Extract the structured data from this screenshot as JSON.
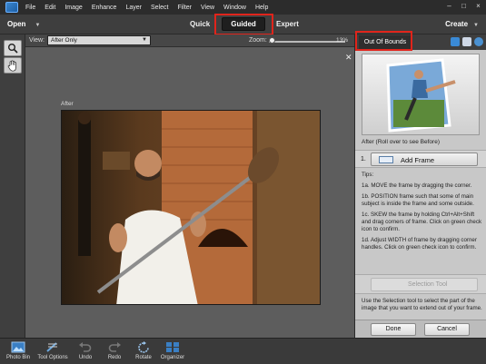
{
  "menubar": {
    "items": [
      "File",
      "Edit",
      "Image",
      "Enhance",
      "Layer",
      "Select",
      "Filter",
      "View",
      "Window",
      "Help"
    ]
  },
  "modebar": {
    "open_label": "Open",
    "modes": [
      "Quick",
      "Guided",
      "Expert"
    ],
    "active_mode": "Guided",
    "create_label": "Create"
  },
  "options": {
    "view_label": "View:",
    "view_value": "After Only",
    "zoom_label": "Zoom:",
    "zoom_value": "13%"
  },
  "canvas": {
    "after_label": "After"
  },
  "panel": {
    "title": "Out Of Bounds",
    "preview_caption": "After (Roll over to see Before)",
    "step_number": "1.",
    "step_button": "Add Frame",
    "tips_heading": "Tips:",
    "tips": [
      "1a. MOVE the frame by dragging the corner.",
      "1b. POSITION frame such that some of main subject is inside the frame and some outside.",
      "1c. SKEW the frame by holding Ctrl+Alt+Shift and drag corners of frame. Click on green check icon to confirm.",
      "1d. Adjust WIDTH of frame by dragging corner handles. Click on green check icon to confirm."
    ],
    "selection_button": "Selection Tool",
    "selection_desc": "Use the Selection tool to select the part of the image that you want to extend out of your frame.",
    "done_label": "Done",
    "cancel_label": "Cancel"
  },
  "bottombar": {
    "items": [
      "Photo Bin",
      "Tool Options",
      "Undo",
      "Redo",
      "Rotate",
      "Organizer"
    ]
  },
  "colors": {
    "highlight": "#e0241b",
    "menubar_bg": "#2c2c2c",
    "panel_bg": "#c8c8c8"
  }
}
